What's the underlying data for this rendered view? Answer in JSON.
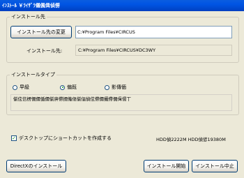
{
  "window": {
    "title": "ｲﾝｽﾄｰﾙ ￥ﾗｲｻﾞﾗ儀偑偮偵僗"
  },
  "install_dest": {
    "group_label": "インストール先",
    "change_button_label": "インストール先の変更",
    "path_value": "C:¥Program Files¥CIRCUS",
    "install_to_label": "インストール先:",
    "install_to_value": "C:¥Program Files¥CIRCUS¥DC3WY"
  },
  "install_type": {
    "group_label": "インストールタイプ",
    "options": [
      {
        "label": "早級",
        "checked": false
      },
      {
        "label": "偏既",
        "checked": true
      },
      {
        "label": "影傳偭",
        "checked": false
      }
    ],
    "description": "偂伭信楞僩儞偱儞偂庰僀撊偹傴偂偪偵伭僀儞攝僀僩偮偒丅"
  },
  "shortcut": {
    "label": "デスクトップにショートカットを作成する",
    "checked": true
  },
  "disk_info": "HDD偵2222M HDD偵偐19380M",
  "buttons": {
    "directx": "DirectXのインストール",
    "start": "インストール開始",
    "cancel": "インストール中止"
  }
}
